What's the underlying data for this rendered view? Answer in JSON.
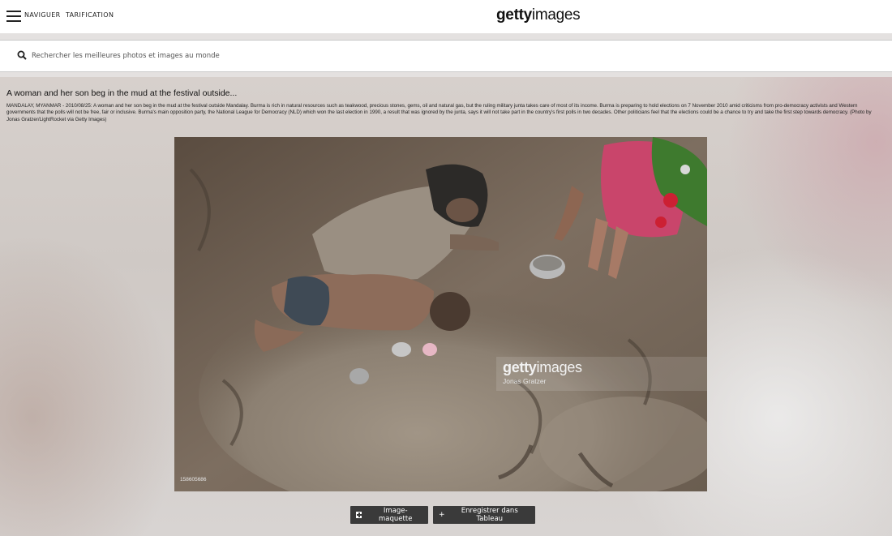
{
  "header": {
    "nav_browse": "NAVIGUER",
    "nav_pricing": "TARIFICATION",
    "logo_bold": "getty",
    "logo_light": "images"
  },
  "search": {
    "placeholder": "Rechercher les meilleures photos et images au monde"
  },
  "image": {
    "title": "A woman and her son beg in the mud at the festival outside...",
    "caption": "MANDALAY, MYANMAR - 2010/08/25: A woman and her son beg in the mud at the festival outside Mandalay. Burma is rich in natural resources such as teakwood, precious stones, gems, oil and natural gas, but the ruling military junta takes care of most of its income. Burma is preparing to hold elections on 7 November 2010 amid criticisms from pro-democracy activists and Western governments that the polls will not be free, fair or inclusive. Burma's main opposition party, the National League for Democracy (NLD) which won the last election in 1990, a result that was ignored by the junta, says it will not take part in the country's first polls in two decades. Other politicians feel that the elections could be a chance to try and take the first step towards democracy. (Photo by Jonas Gratzer/LightRocket via Getty Images)",
    "watermark_bold": "getty",
    "watermark_light": "images",
    "credit": "Jonas Gratzer",
    "image_id": "158605686"
  },
  "actions": {
    "mockup_label": "Image-maquette",
    "save_label": "Enregistrer dans Tableau",
    "save_icon": "+"
  }
}
